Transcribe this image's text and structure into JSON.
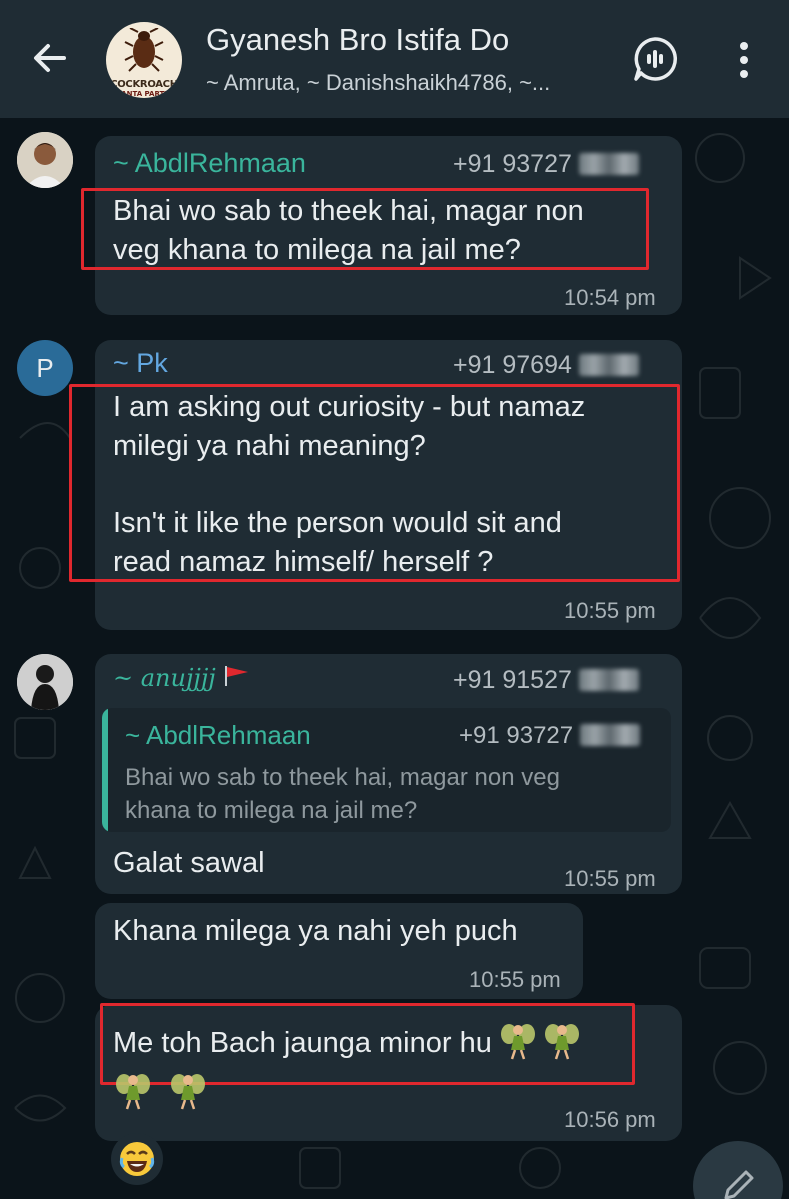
{
  "header": {
    "title": "Gyanesh Bro Istifa Do",
    "subtitle": "~ Amruta, ~ Danishshaikh4786, ~...",
    "group_avatar_text": "COCKROACH",
    "group_avatar_subtext": "JANTA PARTY"
  },
  "messages": [
    {
      "sender": "~ AbdlRehmaan",
      "phone": "+91 93727",
      "text_lines": [
        "Bhai wo sab to theek hai, magar non",
        "veg khana to milega na jail me?"
      ],
      "time": "10:54 pm",
      "sender_color": "#3ab59c"
    },
    {
      "sender": "~ Pk",
      "avatar_letter": "P",
      "phone": "+91 97694",
      "text_lines": [
        "I am asking out curiosity - but namaz",
        "milegi ya nahi meaning?",
        "",
        "Isn't it like the person would sit and",
        "read namaz himself/ herself ?"
      ],
      "time": "10:55 pm",
      "sender_color": "#63a7e0"
    },
    {
      "sender": "~ anujjjj",
      "phone": "+91 91527",
      "reply": {
        "sender": "~ AbdlRehmaan",
        "phone": "+91 93727",
        "text_lines": [
          "Bhai wo sab to theek hai, magar non veg",
          "khana to milega na jail me?"
        ]
      },
      "text": "Galat sawal",
      "time": "10:55 pm",
      "sender_color": "#3ab59c"
    },
    {
      "text": "Khana milega ya nahi yeh puch",
      "time": "10:55 pm"
    },
    {
      "text": "Me toh Bach jaunga minor hu",
      "time": "10:56 pm"
    }
  ],
  "reaction": "😂",
  "colors": {
    "background": "#0b141a",
    "header": "#1f2c34",
    "bubble": "#1f2c34",
    "highlight": "#e0282e"
  }
}
